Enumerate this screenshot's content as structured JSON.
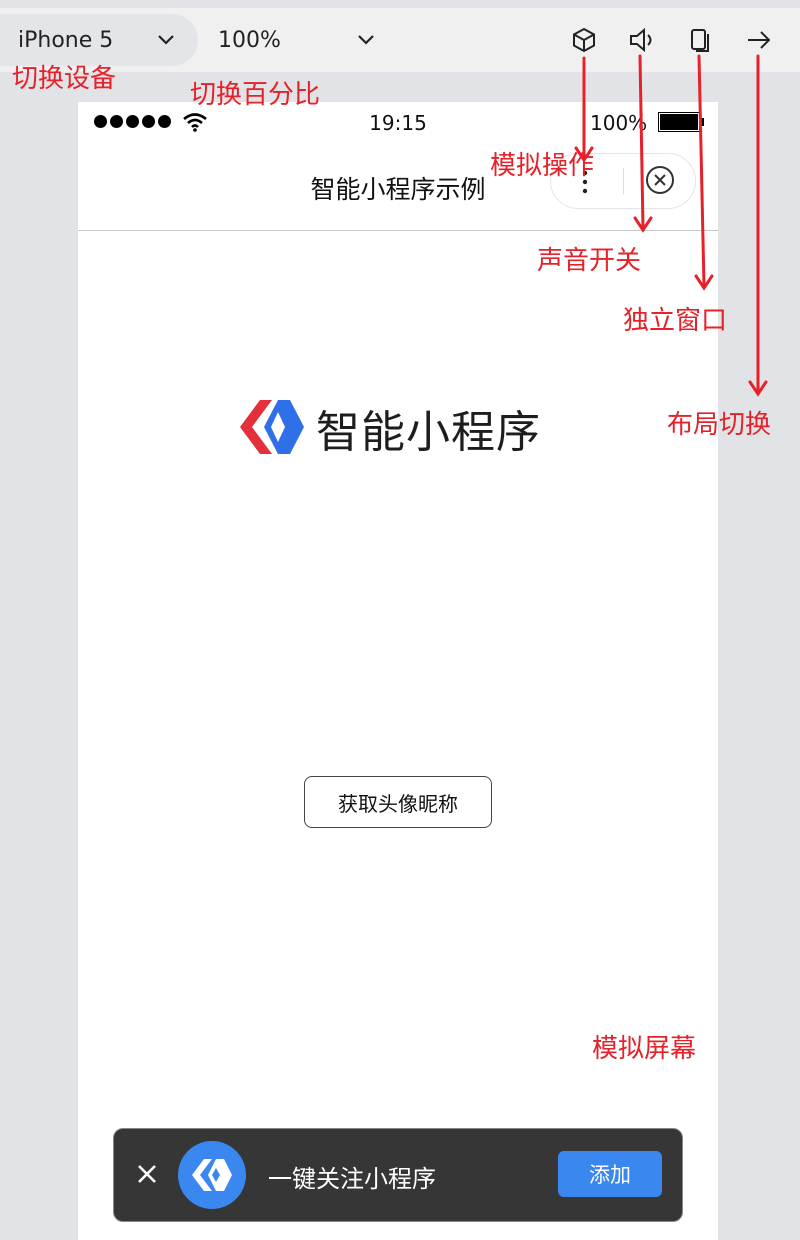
{
  "toolbar": {
    "device_label": "iPhone 5",
    "zoom_label": "100%",
    "icons": [
      "cube-icon",
      "speaker-icon",
      "window-icon",
      "arrow-right-icon"
    ]
  },
  "annotations": {
    "switch_device": "切换设备",
    "switch_percent": "切换百分比",
    "simulate_operation": "模拟操作",
    "sound_switch": "声音开关",
    "standalone_window": "独立窗口",
    "layout_switch": "布局切换",
    "simulate_screen": "模拟屏幕",
    "color": "#e5222a"
  },
  "statusbar": {
    "time": "19:15",
    "battery": "100%"
  },
  "navbar": {
    "title": "智能小程序示例"
  },
  "content": {
    "logo_text": "智能小程序",
    "auth_button": "获取头像昵称"
  },
  "follow_bar": {
    "text": "一键关注小程序",
    "add_button": "添加"
  },
  "colors": {
    "accent": "#3a87f0",
    "logo_red": "#e3303a",
    "logo_blue": "#2f6fe8"
  }
}
